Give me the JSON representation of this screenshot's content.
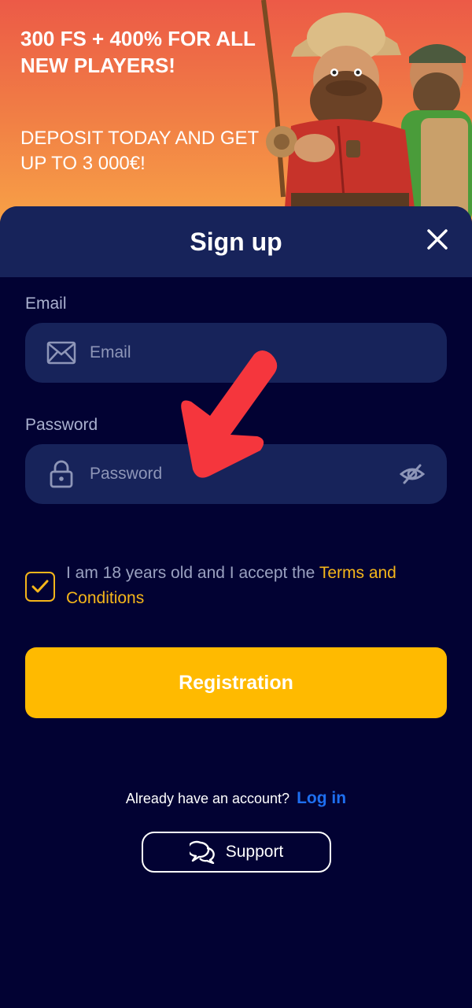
{
  "promo": {
    "title": "300 FS + 400% FOR ALL NEW PLAYERS!",
    "subtitle": "DEPOSIT TODAY AND GET UP TO 3 000€!"
  },
  "signup": {
    "title": "Sign up",
    "close_icon": "close-icon"
  },
  "email": {
    "label": "Email",
    "placeholder": "Email",
    "icon": "envelope-icon"
  },
  "password": {
    "label": "Password",
    "placeholder": "Password",
    "icon": "lock-icon",
    "toggle_icon": "eye-slash-icon"
  },
  "terms": {
    "checked": true,
    "text": "I am 18 years old and I accept the ",
    "link": "Terms and Conditions"
  },
  "registration_button": "Registration",
  "login": {
    "prompt": "Already have an account?",
    "link": "Log in"
  },
  "support": {
    "label": "Support",
    "icon": "chat-bubbles-icon"
  },
  "colors": {
    "background": "#020233",
    "header": "#17235a",
    "field": "#17235a",
    "accent": "#ffba00",
    "link": "#1e6ff0",
    "annotation_arrow": "#f5363d"
  }
}
